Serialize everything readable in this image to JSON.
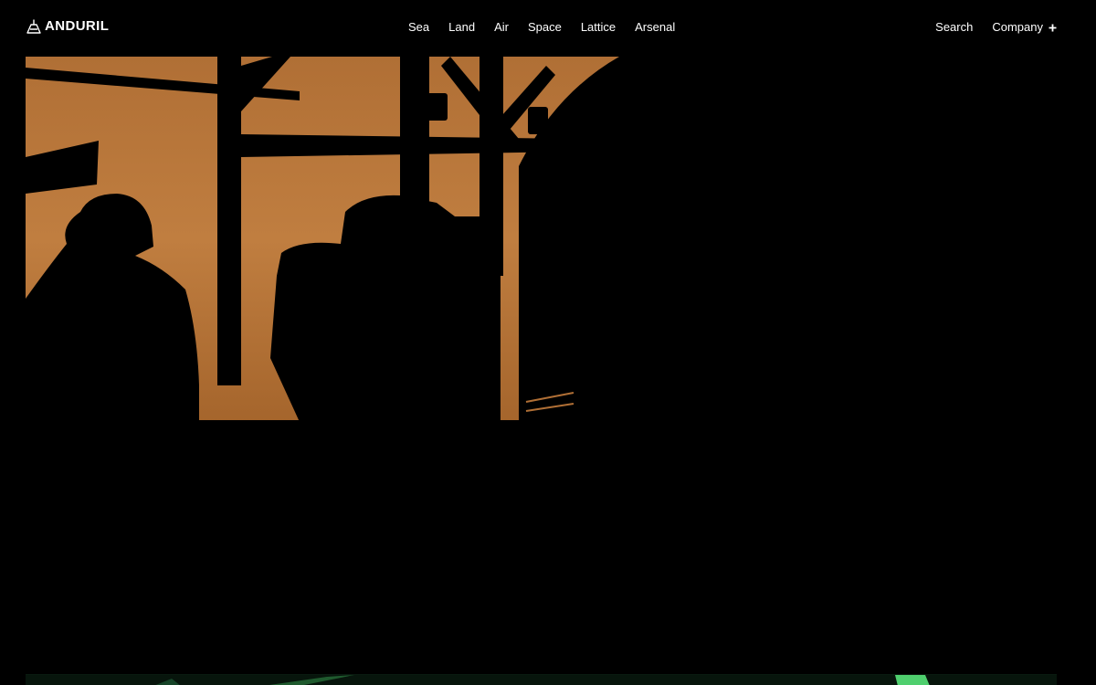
{
  "header": {
    "logo_text": "ANDURIL",
    "logo_icon": "anduril-logo-icon",
    "nav": [
      {
        "label": "Sea"
      },
      {
        "label": "Land"
      },
      {
        "label": "Air"
      },
      {
        "label": "Space"
      },
      {
        "label": "Lattice"
      },
      {
        "label": "Arsenal"
      }
    ],
    "search_label": "Search",
    "company_label": "Company",
    "company_icon": "plus-icon"
  },
  "colors": {
    "background": "#000000",
    "sky_orange": "#b87838",
    "accent_green": "#3a8a4a"
  }
}
